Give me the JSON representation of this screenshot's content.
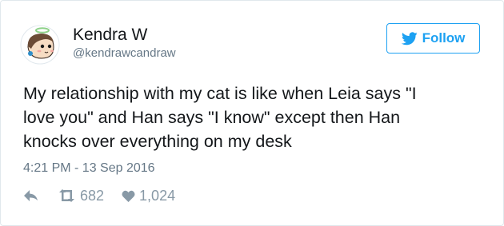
{
  "author": {
    "display_name": "Kendra W",
    "handle": "@kendrawcandraw"
  },
  "follow_button": {
    "label": "Follow",
    "icon": "twitter-bird-icon",
    "color": "#1da1f2"
  },
  "tweet": {
    "lines": [
      "My relationship with my cat is like when Leia says \"I",
      "love you\" and Han says \"I know\" except then Han",
      "knocks over everything on my desk"
    ],
    "timestamp": "4:21 PM - 13 Sep 2016"
  },
  "actions": {
    "reply": {
      "icon": "reply-icon"
    },
    "retweet": {
      "icon": "retweet-icon",
      "count": "682"
    },
    "like": {
      "icon": "heart-icon",
      "count": "1,024"
    }
  },
  "colors": {
    "text_primary": "#14171a",
    "text_secondary": "#657786",
    "action_gray": "#8899a6",
    "border": "#e1e8ed"
  }
}
